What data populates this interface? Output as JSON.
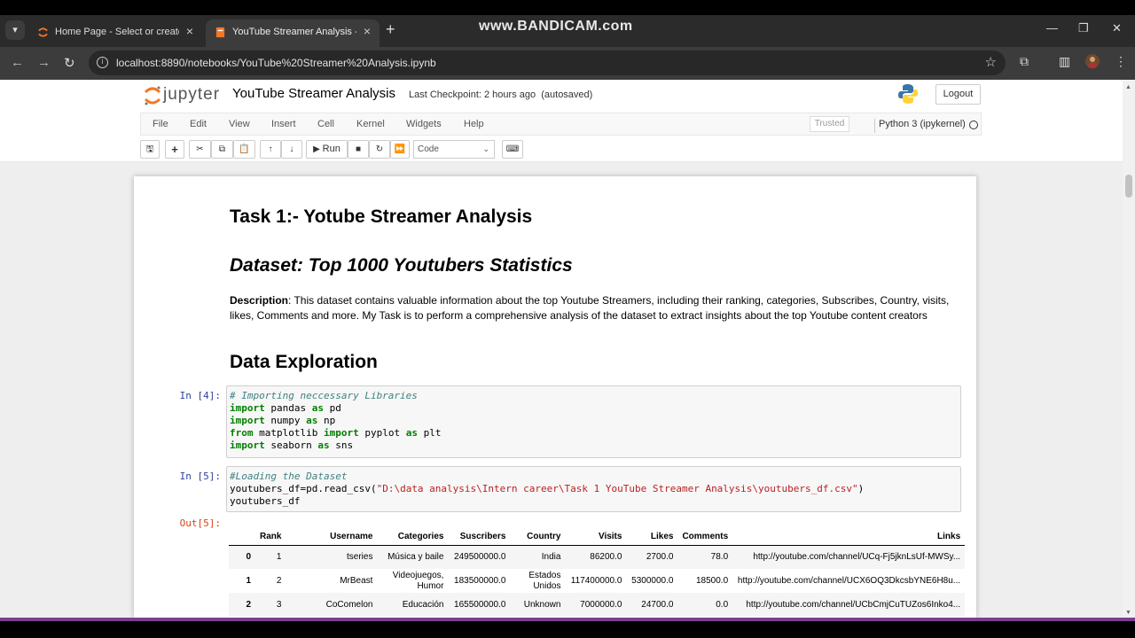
{
  "browser": {
    "tabs": [
      {
        "title": "Home Page - Select or create a notebook",
        "active": false
      },
      {
        "title": "YouTube Streamer Analysis - Jupyter Notebook",
        "active": true
      }
    ],
    "watermark": "www.BANDICAM.com",
    "url": "localhost:8890/notebooks/YouTube%20Streamer%20Analysis.ipynb"
  },
  "jupyter": {
    "logo_text": "jupyter",
    "notebook_name": "YouTube Streamer Analysis",
    "checkpoint_label": "Last Checkpoint:",
    "checkpoint_time": "2 hours ago",
    "autosave": "(autosaved)",
    "logout": "Logout",
    "menus": [
      "File",
      "Edit",
      "View",
      "Insert",
      "Cell",
      "Kernel",
      "Widgets",
      "Help"
    ],
    "trusted": "Trusted",
    "kernel": "Python 3 (ipykernel)",
    "run_label": "Run",
    "cell_type": "Code"
  },
  "notebook": {
    "title": "Task 1:- Yotube Streamer Analysis",
    "dataset": "Dataset: Top 1000 Youtubers Statistics",
    "desc_label": "Description",
    "desc_text": ": This dataset contains valuable information about the top Youtube Streamers, including their ranking, categories, Subscribes, Country, visits, likes, Comments and more. My Task is to perform a comprehensive analysis of the dataset to extract insights about the top Youtube content creators",
    "section": "Data Exploration",
    "prompt4": "In [4]:",
    "prompt5": "In [5]:",
    "out5": "Out[5]:",
    "cell4": {
      "comment": "# Importing neccessary Libraries",
      "lines": [
        {
          "kw1": "import",
          "mod": " pandas ",
          "kw2": "as",
          "alias": " pd"
        },
        {
          "kw1": "import",
          "mod": " numpy ",
          "kw2": "as",
          "alias": " np"
        },
        {
          "kw1": "from",
          "mod": " matplotlib ",
          "kw2": "import",
          "alias": " pyplot ",
          "kw3": "as",
          "alias2": " plt"
        },
        {
          "kw1": "import",
          "mod": " seaborn ",
          "kw2": "as",
          "alias": " sns"
        }
      ]
    },
    "cell5": {
      "comment": "#Loading the Dataset",
      "line1_pre": "youtubers_df=pd.read_csv(",
      "line1_str": "\"D:\\data analysis\\Intern career\\Task 1 YouTube Streamer Analysis\\youtubers_df.csv\"",
      "line1_post": ")",
      "line2": "youtubers_df"
    },
    "table": {
      "columns": [
        "",
        "Rank",
        "Username",
        "Categories",
        "Suscribers",
        "Country",
        "Visits",
        "Likes",
        "Comments",
        "Links"
      ],
      "rows": [
        [
          "0",
          "1",
          "tseries",
          "Música y baile",
          "249500000.0",
          "India",
          "86200.0",
          "2700.0",
          "78.0",
          "http://youtube.com/channel/UCq-Fj5jknLsUf-MWSy..."
        ],
        [
          "1",
          "2",
          "MrBeast",
          "Videojuegos, Humor",
          "183500000.0",
          "Estados Unidos",
          "117400000.0",
          "5300000.0",
          "18500.0",
          "http://youtube.com/channel/UCX6OQ3DkcsbYNE6H8u..."
        ],
        [
          "2",
          "3",
          "CoComelon",
          "Educación",
          "165500000.0",
          "Unknown",
          "7000000.0",
          "24700.0",
          "0.0",
          "http://youtube.com/channel/UCbCmjCuTUZos6Inko4..."
        ]
      ]
    }
  }
}
